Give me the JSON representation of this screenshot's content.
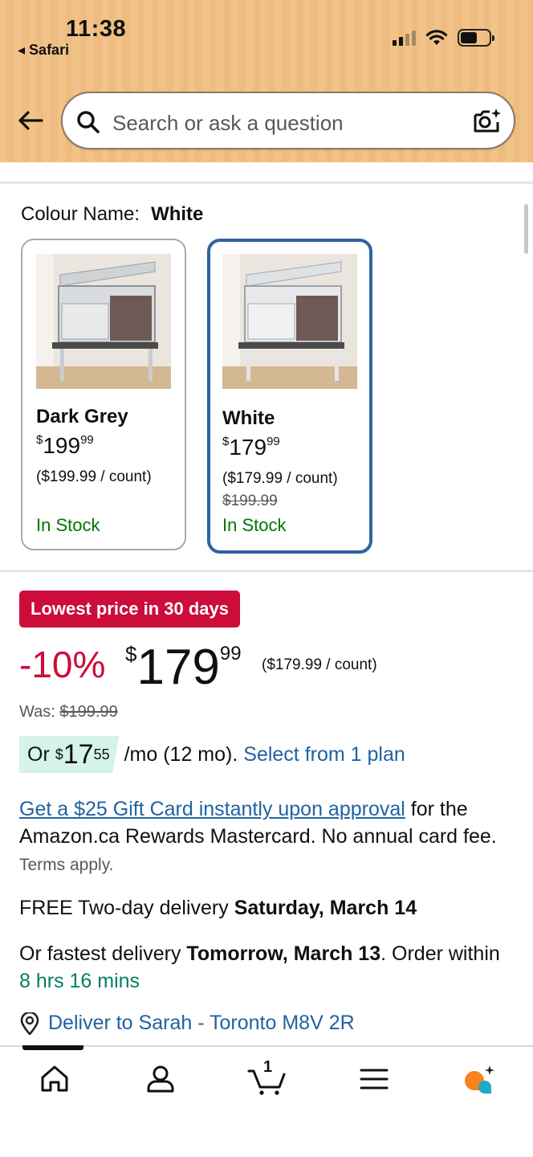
{
  "status_bar": {
    "time": "11:38",
    "back_app": "Safari"
  },
  "search": {
    "placeholder": "Search or ask a question"
  },
  "colour": {
    "label": "Colour Name:",
    "selected": "White",
    "options": [
      {
        "name": "Dark Grey",
        "currency": "$",
        "price_whole": "199",
        "price_cents": "99",
        "unit_price": "($199.99 / count)",
        "was": "",
        "stock": "In Stock",
        "selected": false
      },
      {
        "name": "White",
        "currency": "$",
        "price_whole": "179",
        "price_cents": "99",
        "unit_price": "($179.99 / count)",
        "was": "$199.99",
        "stock": "In Stock",
        "selected": true
      }
    ]
  },
  "price": {
    "badge": "Lowest price in 30 days",
    "discount": "-10%",
    "currency": "$",
    "whole": "179",
    "cents": "99",
    "unit_price": "($179.99 / count)",
    "was_label": "Was:",
    "was_value": "$199.99"
  },
  "installment": {
    "or": "Or",
    "currency": "$",
    "whole": "17",
    "cents": "55",
    "term": "/mo (12 mo).",
    "link": "Select from 1 plan"
  },
  "promo": {
    "link": "Get a $25 Gift Card instantly upon approval",
    "text": "for the Amazon.ca Rewards Mastercard. No annual card fee.",
    "terms": "Terms apply."
  },
  "delivery": {
    "free_prefix": "FREE Two-day delivery",
    "free_date": "Saturday, March 14",
    "fast_prefix": "Or fastest delivery",
    "fast_date": "Tomorrow, March 13",
    "order_within": ". Order within",
    "countdown": "8 hrs 16 mins",
    "deliver_to": "Deliver to Sarah - Toronto M8V 2R"
  },
  "nav": {
    "cart_count": "1"
  },
  "colors": {
    "header": "#f2c389",
    "link": "#2162a1",
    "deal_red": "#cc0c39",
    "stock_green": "#007600",
    "selected_border": "#2f63a0"
  }
}
